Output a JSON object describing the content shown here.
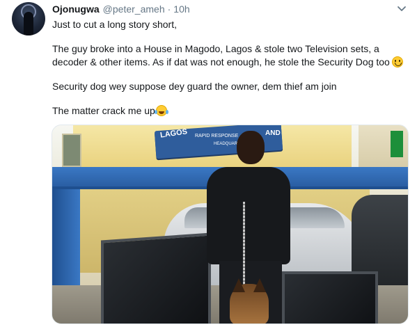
{
  "tweet": {
    "display_name": "Ojonugwa",
    "handle": "@peter_ameh",
    "separator": "·",
    "time": "10h",
    "lines": [
      "Just to cut a long story short,",
      "",
      "The guy broke into a House in Magodo, Lagos & stole two Television sets, a",
      "decoder & other items. As if dat was not enough, he stole the Security Dog too",
      "",
      "Security dog wey suppose dey guard the owner, dem thief am join",
      "",
      "The matter crack me up"
    ]
  },
  "photo": {
    "sign_text": "LAGOS",
    "sign_text_2": "RAPID RESPONSE",
    "sign_text_3": "HEADQUARTERS",
    "sign_suffix": "AND"
  },
  "colors": {
    "text_primary": "#14171a",
    "text_secondary": "#657786",
    "border": "#e1e8ed"
  },
  "icons": {
    "menu": "chevron-down-icon",
    "emoji_1": "grinning-face-emoji",
    "emoji_2": "face-with-tears-of-joy-emoji"
  }
}
